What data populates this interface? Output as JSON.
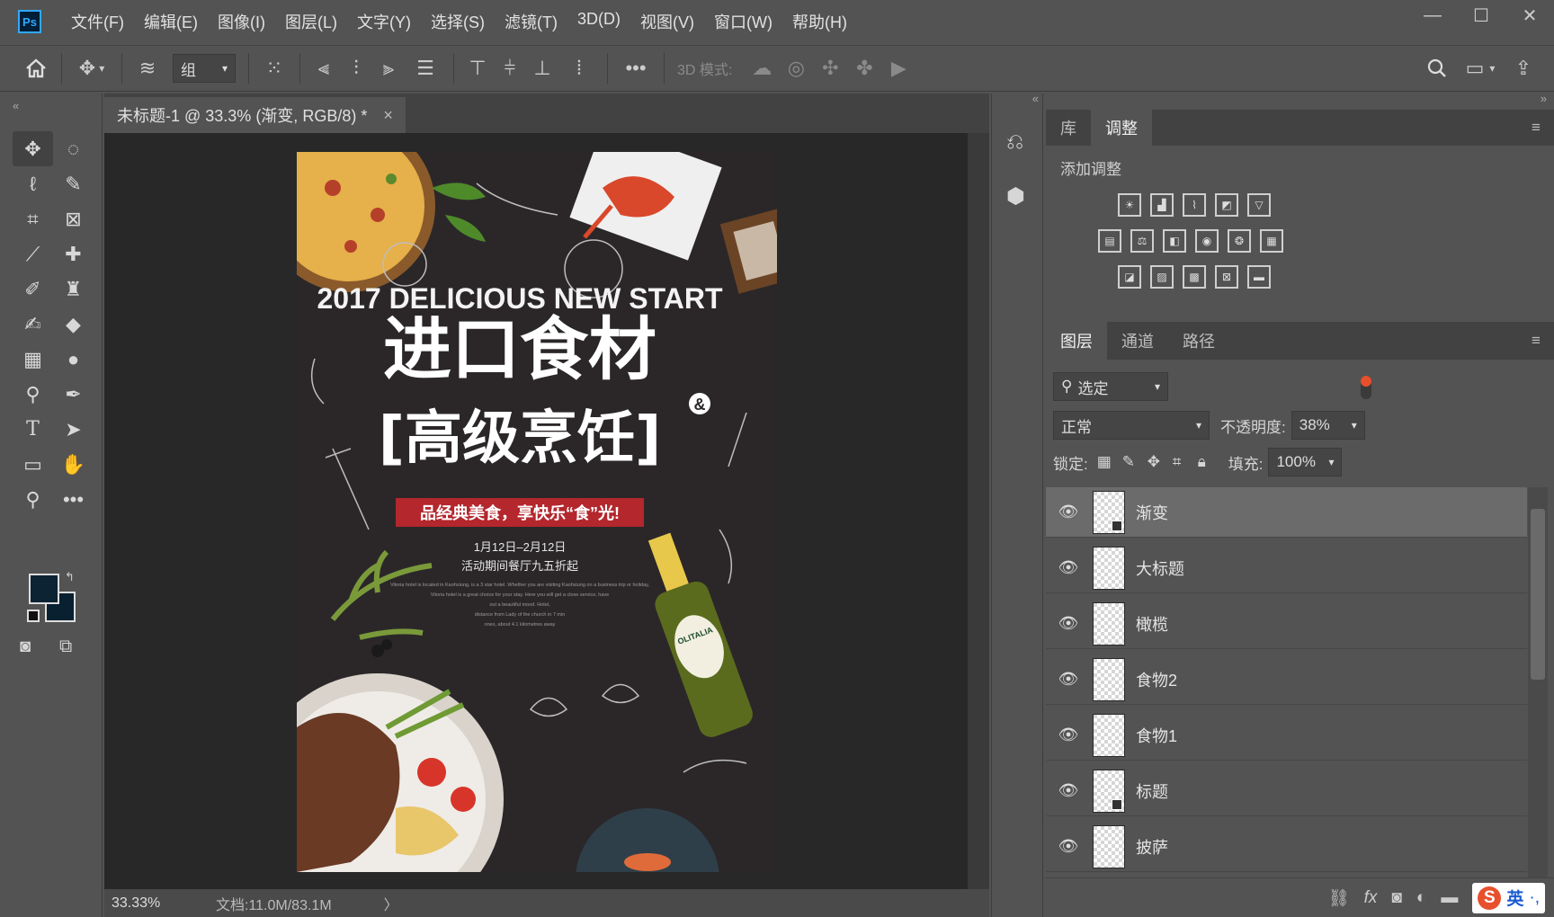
{
  "app": {
    "logo": "Ps"
  },
  "menu": [
    "文件(F)",
    "编辑(E)",
    "图像(I)",
    "图层(L)",
    "文字(Y)",
    "选择(S)",
    "滤镜(T)",
    "3D(D)",
    "视图(V)",
    "窗口(W)",
    "帮助(H)"
  ],
  "window_controls": {
    "minimize": "—",
    "maximize": "☐",
    "close": "✕"
  },
  "options": {
    "auto_select_value": "组",
    "mode_3d_label": "3D 模式:"
  },
  "document": {
    "tab_title": "未标题-1 @ 33.3% (渐变, RGB/8) *",
    "tab_close": "×",
    "zoom": "33.33%",
    "doc_info": "文档:11.0M/83.1M",
    "status_arrow": "〉"
  },
  "poster": {
    "headline_en": "2017 DELICIOUS NEW START",
    "title_line1": "进口食材",
    "amp": "&",
    "title_line2": "[高级烹饪]",
    "banner": "品经典美食，享快乐“食”光!",
    "date": "1月12日–2月12日",
    "promo": "活动期间餐厅九五折起",
    "body_1": "Vitoria hotel is located in Kaohsiung, is a 3 star hotel. Whether you are visiting Kaohsiung on a business trip or holiday,",
    "body_2": "Vitoria hotel is a great choice for your stay. Here you will get a close service, have",
    "body_3": "out a beautiful mood. Hotel,",
    "body_4": "distance from Lady of the church in 7 min",
    "body_5": "ones, about 4.1 kilometres away",
    "bottle_brand": "OLITALIA"
  },
  "panels": {
    "top_tabs": [
      "库",
      "调整"
    ],
    "top_active": "调整",
    "add_adjust": "添加调整",
    "layer_tabs": [
      "图层",
      "通道",
      "路径"
    ],
    "filter_value": "选定",
    "blend_mode": "正常",
    "opacity_label": "不透明度:",
    "opacity_value": "38%",
    "lock_label": "锁定:",
    "fill_label": "填充:",
    "fill_value": "100%",
    "layers": [
      {
        "name": "渐变",
        "selected": true
      },
      {
        "name": "大标题",
        "selected": false
      },
      {
        "name": "橄榄",
        "selected": false
      },
      {
        "name": "食物2",
        "selected": false
      },
      {
        "name": "食物1",
        "selected": false
      },
      {
        "name": "标题",
        "selected": false
      },
      {
        "name": "披萨",
        "selected": false
      }
    ],
    "bottom_fx": "fx",
    "ime_label": "英"
  },
  "colors": {
    "accent": "#31a8ff",
    "banner_red": "#b3272d",
    "foreground": "#0c2333",
    "background": "#082030",
    "status_dot": "#e8502c"
  }
}
